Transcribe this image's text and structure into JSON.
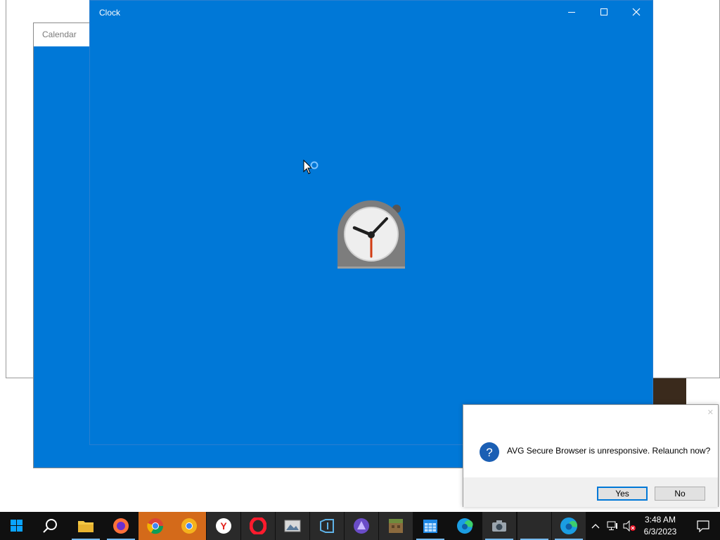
{
  "background_windows": {
    "calendar": {
      "title": "Calendar"
    }
  },
  "clock_window": {
    "title": "Clock",
    "controls": {
      "minimize": "minimize-icon",
      "maximize": "maximize-icon",
      "close": "close-icon"
    },
    "splash_icon": "alarm-clock-icon",
    "background_color": "#0078d7"
  },
  "dialog": {
    "message": "AVG Secure Browser is unresponsive. Relaunch now?",
    "icon": "question-icon",
    "yes_label": "Yes",
    "no_label": "No"
  },
  "taskbar": {
    "apps": [
      "windows-start-icon",
      "search-icon",
      "file-explorer-icon",
      "firefox-icon",
      "chrome-icon",
      "chrome-canary-icon",
      "yandex-browser-icon",
      "opera-icon",
      "photos-viewer-icon",
      "visual-studio-icon",
      "pinnacle-icon",
      "minecraft-icon",
      "calendar-icon",
      "edge-icon",
      "camera-icon",
      "blank-app-icon",
      "edge-beta-icon"
    ],
    "tray_icons": [
      "chevron-up-icon",
      "network-icon",
      "volume-muted-icon",
      "notifications-icon"
    ],
    "time": "3:48 AM",
    "date": "6/3/2023"
  },
  "colors": {
    "accent": "#0078d7",
    "taskbar": "#101010",
    "highlight": "#d46a1a"
  }
}
